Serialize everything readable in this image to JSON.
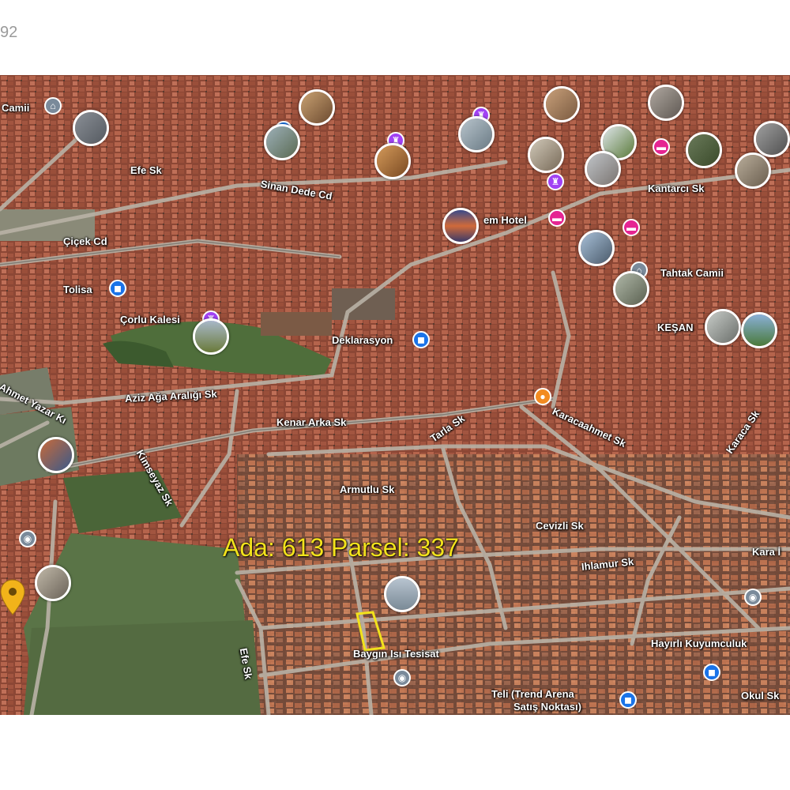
{
  "corner_text": "92",
  "parcel_label": "Ada: 613  Parsel: 337",
  "colors": {
    "parcel_label": "#f2e21c",
    "location_pin": "#f2b31a",
    "poi_blue": "#1a73e8",
    "poi_purple": "#a142f4",
    "poi_pink": "#e52592",
    "poi_orange": "#f28b21",
    "poi_gray": "#7a8a9a"
  },
  "street_labels": {
    "efe_sk_top": "Efe Sk",
    "sinan_dede": "Sinan Dede Cd",
    "cicek_cd": "Çiçek Cd",
    "tolisa": "Tolisa",
    "corlu_kalesi": "Çorlu Kalesi",
    "aziz_aga": "Aziz Ağa Aralığı Sk",
    "kenar_arka": "Kenar Arka Sk",
    "ahmet_yazar": "Ahmet Yazar Kı",
    "kimseyaz": "Kimseyaz Sk",
    "armutlu": "Armutlu Sk",
    "tarla": "Tarla Sk",
    "karacaahmet": "Karacaahmet Sk",
    "karaca_right": "Karaca Sk",
    "cevizli": "Cevizli Sk",
    "ihlamur": "Ihlamur Sk",
    "kara_right": "Kara İ",
    "efe_sk_bottom": "Efe Sk",
    "kantarci": "Kantarcı Sk",
    "tahtak_camii": "Tahtak Camii",
    "kesan": "KEŞAN",
    "hotel": "em Hotel",
    "deklarasyon": "Deklarasyon",
    "camii_top": "Camii",
    "baygin": "Baygın Isı Tesisat",
    "hayirli": "Hayırlı Kuyumculuk",
    "teli_trend": "Teli (Trend Arena",
    "satis_noktasi": "Satış Noktası)",
    "okul_sk": "Okul Sk"
  },
  "poi_icons": [
    "place-icon",
    "shopping-cart-icon",
    "landmark-icon",
    "landmark-icon",
    "hotel-icon",
    "museum-icon",
    "cafe-icon",
    "hotel-icon",
    "mosque-icon",
    "shopping-icon"
  ]
}
